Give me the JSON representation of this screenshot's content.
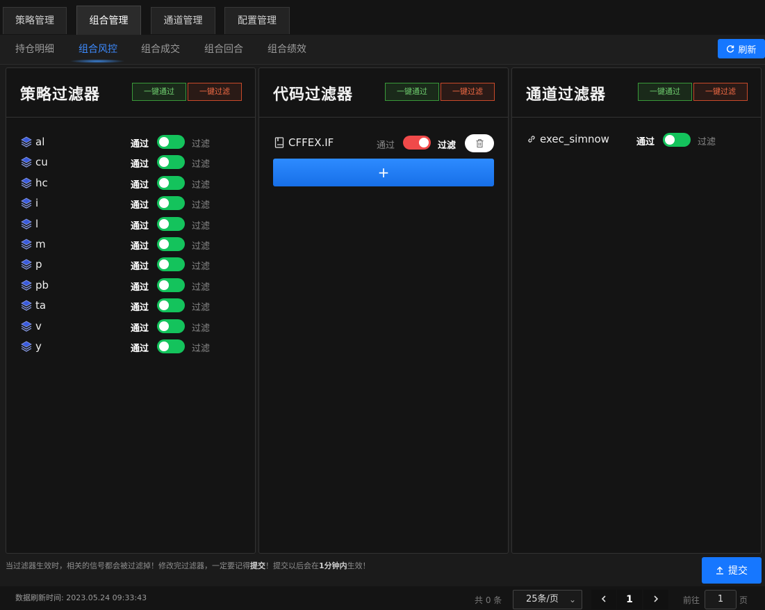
{
  "top_tabs": [
    "策略管理",
    "组合管理",
    "通道管理",
    "配置管理"
  ],
  "active_top_tab": "组合管理",
  "sub_tabs": [
    "持仓明细",
    "组合风控",
    "组合成交",
    "组合回合",
    "组合绩效"
  ],
  "active_sub_tab": "组合风控",
  "refresh_label": "刷新",
  "pass_all_label": "一键通过",
  "filter_all_label": "一键过滤",
  "pass_label": "通过",
  "filter_label": "过滤",
  "strategy_filter": {
    "title": "策略过滤器",
    "items": [
      {
        "name": "al",
        "state": "通过"
      },
      {
        "name": "cu",
        "state": "通过"
      },
      {
        "name": "hc",
        "state": "通过"
      },
      {
        "name": "i",
        "state": "通过"
      },
      {
        "name": "l",
        "state": "通过"
      },
      {
        "name": "m",
        "state": "通过"
      },
      {
        "name": "p",
        "state": "通过"
      },
      {
        "name": "pb",
        "state": "通过"
      },
      {
        "name": "ta",
        "state": "通过"
      },
      {
        "name": "v",
        "state": "通过"
      },
      {
        "name": "y",
        "state": "通过"
      }
    ]
  },
  "code_filter": {
    "title": "代码过滤器",
    "items": [
      {
        "name": "CFFEX.IF",
        "state": "过滤"
      }
    ],
    "add_label": "+"
  },
  "channel_filter": {
    "title": "通道过滤器",
    "items": [
      {
        "name": "exec_simnow",
        "state": "通过"
      }
    ]
  },
  "notice": {
    "part1": "当过滤器生效时，相关的信号都会被过滤掉！修改完过滤器，一定要记得",
    "bold1": "提交",
    "part2": "！提交以后会在",
    "bold2": "1分钟内",
    "part3": "生效！"
  },
  "submit_label": "提交",
  "refresh_time": "数据刷新时间: 2023.05.24 09:33:43",
  "pagination": {
    "total": "共 0 条",
    "page_size": "25条/页",
    "current_page": "1",
    "goto_label": "前往",
    "goto_value": "1",
    "page_unit": "页"
  },
  "colors": {
    "accent": "#1677ff",
    "switch_on": "#14c35c",
    "switch_filter": "#f04a4a"
  },
  "icons": {
    "strategy_item": "layers-icon",
    "code_item": "book-icon",
    "channel_item": "link-icon",
    "delete": "trash-icon",
    "refresh": "refresh-icon",
    "submit": "upload-icon"
  }
}
